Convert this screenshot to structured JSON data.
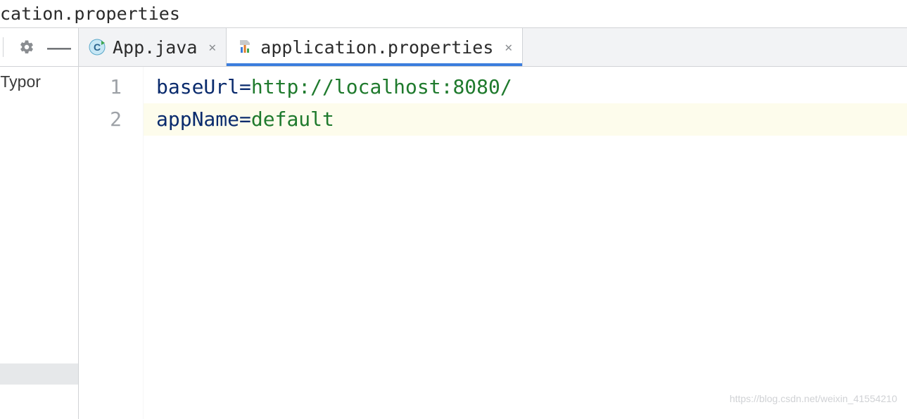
{
  "path_bar": {
    "text": "cation.properties"
  },
  "sidebar": {
    "tree_item": "oadTypor"
  },
  "tabs": [
    {
      "label": "App.java",
      "active": false,
      "icon": "java-class-icon"
    },
    {
      "label": "application.properties",
      "active": true,
      "icon": "properties-icon"
    }
  ],
  "editor": {
    "line_numbers": [
      "1",
      "2"
    ],
    "current_line_index": 1,
    "code": [
      {
        "key": "baseUrl",
        "value": "http://localhost:8080/"
      },
      {
        "key": "appName",
        "value": "default"
      }
    ]
  },
  "watermark": "https://blog.csdn.net/weixin_41554210"
}
